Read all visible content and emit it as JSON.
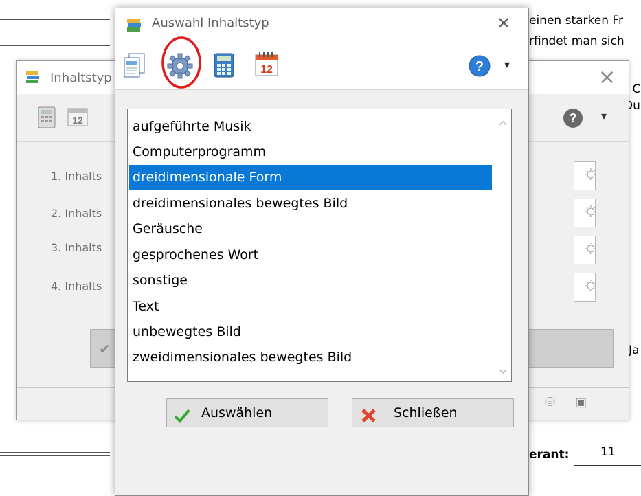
{
  "background_doc": {
    "text_lines": [
      "einen starken Fr",
      "rfindet man sich",
      "r C",
      "Du"
    ],
    "price_label": "erant:",
    "price_value": "11",
    "bottom_label": "Ja"
  },
  "back_dialog": {
    "title": "Inhaltstyp",
    "rows": [
      "1. Inhalts",
      "2. Inhalts",
      "3. Inhalts",
      "4. Inhalts"
    ],
    "close": "×"
  },
  "dialog": {
    "title": "Auswahl Inhaltstyp",
    "close": "✕",
    "toolbar": {
      "icons": [
        "documents-icon",
        "gear-icon",
        "calculator-icon",
        "calendar-icon"
      ],
      "calendar_day": "12",
      "help": "?",
      "dropdown": "▾"
    },
    "list": {
      "items": [
        "aufgeführte Musik",
        "Computerprogramm",
        "dreidimensionale Form",
        "dreidimensionales bewegtes Bild",
        "Geräusche",
        "gesprochenes Wort",
        "sonstige",
        "Text",
        "unbewegtes Bild",
        "zweidimensionales bewegtes Bild"
      ],
      "selected_index": 2
    },
    "buttons": {
      "select_label": "Auswählen",
      "close_label": "Schließen"
    },
    "colors": {
      "selection": "#0a78d7",
      "highlight_circle": "#e01b1b",
      "check_green": "#3aa632",
      "close_red": "#e2412b"
    }
  }
}
